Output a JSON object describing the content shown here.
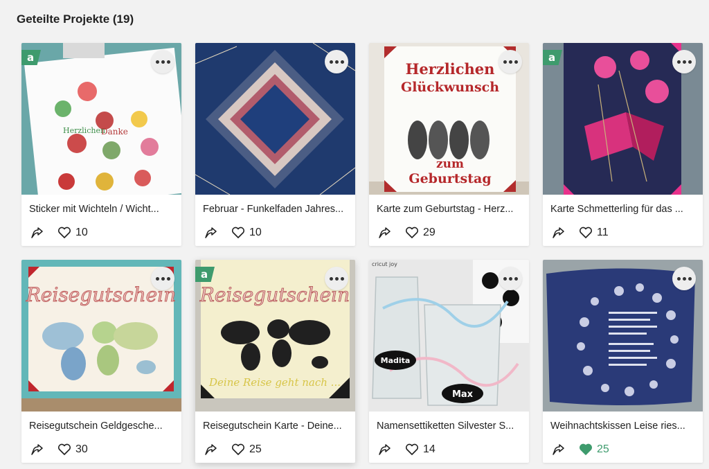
{
  "section": {
    "title": "Geteilte Projekte (19)"
  },
  "badge_label": "a",
  "colors": {
    "liked": "#3e9b6d",
    "badge": "#3e9b6d"
  },
  "cards": [
    {
      "title": "Sticker mit Wichteln / Wicht...",
      "likes": "10",
      "liked": false,
      "badge": true
    },
    {
      "title": "Februar - Funkelfaden Jahres...",
      "likes": "10",
      "liked": false,
      "badge": false
    },
    {
      "title": "Karte zum Geburtstag - Herz...",
      "likes": "29",
      "liked": false,
      "badge": false,
      "image_text": [
        "Herzlichen",
        "Glückwunsch",
        "zum",
        "Geburtstag"
      ]
    },
    {
      "title": "Karte Schmetterling für das ...",
      "likes": "11",
      "liked": false,
      "badge": true
    },
    {
      "title": "Reisegutschein Geldgesche...",
      "likes": "30",
      "liked": false,
      "badge": false,
      "image_text": [
        "Reisegutschein"
      ]
    },
    {
      "title": "Reisegutschein Karte - Deine...",
      "likes": "25",
      "liked": false,
      "badge": true,
      "image_text": [
        "Reisegutschein",
        "Deine Reise geht nach ..."
      ]
    },
    {
      "title": "Namensettiketten Silvester S...",
      "likes": "14",
      "liked": false,
      "badge": false,
      "image_text": [
        "cricut joy",
        "Madita",
        "Max"
      ]
    },
    {
      "title": "Weihnachtskissen Leise ries...",
      "likes": "25",
      "liked": true,
      "badge": false
    }
  ]
}
